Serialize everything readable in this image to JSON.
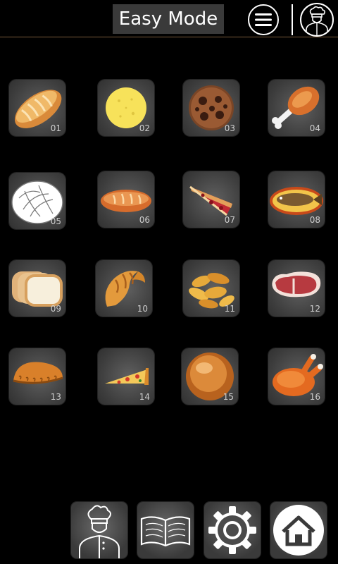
{
  "header": {
    "title": "Easy Mode",
    "menu_icon": "hamburger-menu-icon",
    "profile_icon": "chef-avatar-icon"
  },
  "programs": [
    {
      "number": "01",
      "food": "bread-loaf"
    },
    {
      "number": "02",
      "food": "cheese"
    },
    {
      "number": "03",
      "food": "cookie"
    },
    {
      "number": "04",
      "food": "chicken-drumstick"
    },
    {
      "number": "05",
      "food": "round-bread"
    },
    {
      "number": "06",
      "food": "baguette"
    },
    {
      "number": "07",
      "food": "tart-slice"
    },
    {
      "number": "08",
      "food": "fish"
    },
    {
      "number": "09",
      "food": "sliced-bread"
    },
    {
      "number": "10",
      "food": "croissant"
    },
    {
      "number": "11",
      "food": "potato-wedges"
    },
    {
      "number": "12",
      "food": "steak"
    },
    {
      "number": "13",
      "food": "empanada"
    },
    {
      "number": "14",
      "food": "pizza-slice"
    },
    {
      "number": "15",
      "food": "bun"
    },
    {
      "number": "16",
      "food": "roast-chicken"
    }
  ],
  "bottom_bar": {
    "buttons": [
      "chef-icon",
      "recipe-book-icon",
      "settings-gear-icon",
      "home-icon"
    ]
  },
  "colors": {
    "background": "#000000",
    "tile": "#3d3d3d",
    "header_rule": "#7a5a3a",
    "title_box": "#3a3a3a"
  }
}
